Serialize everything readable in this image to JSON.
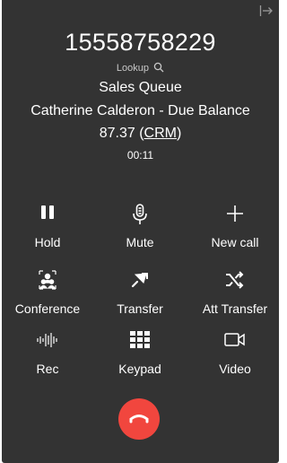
{
  "call": {
    "number": "15558758229",
    "lookup_label": "Lookup",
    "queue": "Sales Queue",
    "caller": "Catherine Calderon - Due Balance",
    "amount": "87.37",
    "crm_open": "(",
    "crm_label": "CRM",
    "crm_close": ")",
    "timer": "00:11"
  },
  "controls": {
    "hold": {
      "label": "Hold",
      "icon": "pause-icon"
    },
    "mute": {
      "label": "Mute",
      "icon": "microphone-icon"
    },
    "new_call": {
      "label": "New call",
      "icon": "plus-icon"
    },
    "conference": {
      "label": "Conference",
      "icon": "conference-icon"
    },
    "transfer": {
      "label": "Transfer",
      "icon": "transfer-icon"
    },
    "att_transfer": {
      "label": "Att Transfer",
      "icon": "shuffle-icon"
    },
    "rec": {
      "label": "Rec",
      "icon": "waveform-icon"
    },
    "keypad": {
      "label": "Keypad",
      "icon": "keypad-icon"
    },
    "video": {
      "label": "Video",
      "icon": "video-camera-icon"
    }
  },
  "colors": {
    "panel_bg": "#333333",
    "text": "#ffffff",
    "hangup": "#f1463e"
  }
}
